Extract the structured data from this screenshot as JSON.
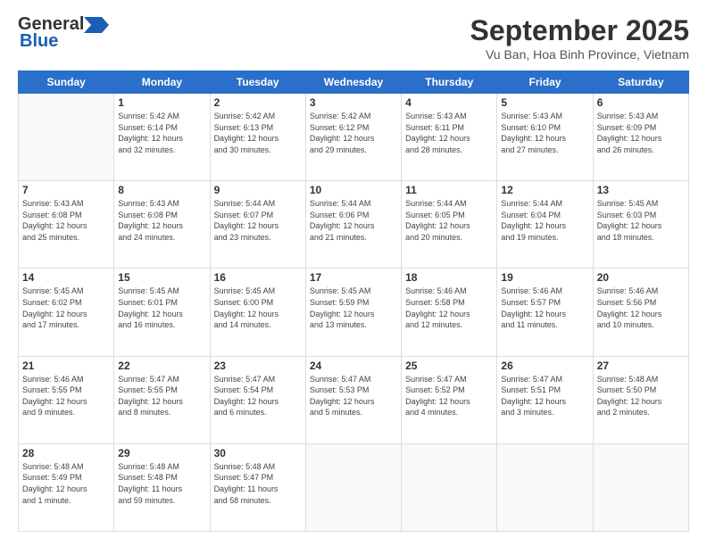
{
  "header": {
    "logo_line1": "General",
    "logo_line2": "Blue",
    "title": "September 2025",
    "location": "Vu Ban, Hoa Binh Province, Vietnam"
  },
  "weekdays": [
    "Sunday",
    "Monday",
    "Tuesday",
    "Wednesday",
    "Thursday",
    "Friday",
    "Saturday"
  ],
  "weeks": [
    [
      {
        "day": "",
        "info": ""
      },
      {
        "day": "1",
        "info": "Sunrise: 5:42 AM\nSunset: 6:14 PM\nDaylight: 12 hours\nand 32 minutes."
      },
      {
        "day": "2",
        "info": "Sunrise: 5:42 AM\nSunset: 6:13 PM\nDaylight: 12 hours\nand 30 minutes."
      },
      {
        "day": "3",
        "info": "Sunrise: 5:42 AM\nSunset: 6:12 PM\nDaylight: 12 hours\nand 29 minutes."
      },
      {
        "day": "4",
        "info": "Sunrise: 5:43 AM\nSunset: 6:11 PM\nDaylight: 12 hours\nand 28 minutes."
      },
      {
        "day": "5",
        "info": "Sunrise: 5:43 AM\nSunset: 6:10 PM\nDaylight: 12 hours\nand 27 minutes."
      },
      {
        "day": "6",
        "info": "Sunrise: 5:43 AM\nSunset: 6:09 PM\nDaylight: 12 hours\nand 26 minutes."
      }
    ],
    [
      {
        "day": "7",
        "info": "Sunrise: 5:43 AM\nSunset: 6:08 PM\nDaylight: 12 hours\nand 25 minutes."
      },
      {
        "day": "8",
        "info": "Sunrise: 5:43 AM\nSunset: 6:08 PM\nDaylight: 12 hours\nand 24 minutes."
      },
      {
        "day": "9",
        "info": "Sunrise: 5:44 AM\nSunset: 6:07 PM\nDaylight: 12 hours\nand 23 minutes."
      },
      {
        "day": "10",
        "info": "Sunrise: 5:44 AM\nSunset: 6:06 PM\nDaylight: 12 hours\nand 21 minutes."
      },
      {
        "day": "11",
        "info": "Sunrise: 5:44 AM\nSunset: 6:05 PM\nDaylight: 12 hours\nand 20 minutes."
      },
      {
        "day": "12",
        "info": "Sunrise: 5:44 AM\nSunset: 6:04 PM\nDaylight: 12 hours\nand 19 minutes."
      },
      {
        "day": "13",
        "info": "Sunrise: 5:45 AM\nSunset: 6:03 PM\nDaylight: 12 hours\nand 18 minutes."
      }
    ],
    [
      {
        "day": "14",
        "info": "Sunrise: 5:45 AM\nSunset: 6:02 PM\nDaylight: 12 hours\nand 17 minutes."
      },
      {
        "day": "15",
        "info": "Sunrise: 5:45 AM\nSunset: 6:01 PM\nDaylight: 12 hours\nand 16 minutes."
      },
      {
        "day": "16",
        "info": "Sunrise: 5:45 AM\nSunset: 6:00 PM\nDaylight: 12 hours\nand 14 minutes."
      },
      {
        "day": "17",
        "info": "Sunrise: 5:45 AM\nSunset: 5:59 PM\nDaylight: 12 hours\nand 13 minutes."
      },
      {
        "day": "18",
        "info": "Sunrise: 5:46 AM\nSunset: 5:58 PM\nDaylight: 12 hours\nand 12 minutes."
      },
      {
        "day": "19",
        "info": "Sunrise: 5:46 AM\nSunset: 5:57 PM\nDaylight: 12 hours\nand 11 minutes."
      },
      {
        "day": "20",
        "info": "Sunrise: 5:46 AM\nSunset: 5:56 PM\nDaylight: 12 hours\nand 10 minutes."
      }
    ],
    [
      {
        "day": "21",
        "info": "Sunrise: 5:46 AM\nSunset: 5:55 PM\nDaylight: 12 hours\nand 9 minutes."
      },
      {
        "day": "22",
        "info": "Sunrise: 5:47 AM\nSunset: 5:55 PM\nDaylight: 12 hours\nand 8 minutes."
      },
      {
        "day": "23",
        "info": "Sunrise: 5:47 AM\nSunset: 5:54 PM\nDaylight: 12 hours\nand 6 minutes."
      },
      {
        "day": "24",
        "info": "Sunrise: 5:47 AM\nSunset: 5:53 PM\nDaylight: 12 hours\nand 5 minutes."
      },
      {
        "day": "25",
        "info": "Sunrise: 5:47 AM\nSunset: 5:52 PM\nDaylight: 12 hours\nand 4 minutes."
      },
      {
        "day": "26",
        "info": "Sunrise: 5:47 AM\nSunset: 5:51 PM\nDaylight: 12 hours\nand 3 minutes."
      },
      {
        "day": "27",
        "info": "Sunrise: 5:48 AM\nSunset: 5:50 PM\nDaylight: 12 hours\nand 2 minutes."
      }
    ],
    [
      {
        "day": "28",
        "info": "Sunrise: 5:48 AM\nSunset: 5:49 PM\nDaylight: 12 hours\nand 1 minute."
      },
      {
        "day": "29",
        "info": "Sunrise: 5:48 AM\nSunset: 5:48 PM\nDaylight: 11 hours\nand 59 minutes."
      },
      {
        "day": "30",
        "info": "Sunrise: 5:48 AM\nSunset: 5:47 PM\nDaylight: 11 hours\nand 58 minutes."
      },
      {
        "day": "",
        "info": ""
      },
      {
        "day": "",
        "info": ""
      },
      {
        "day": "",
        "info": ""
      },
      {
        "day": "",
        "info": ""
      }
    ]
  ]
}
